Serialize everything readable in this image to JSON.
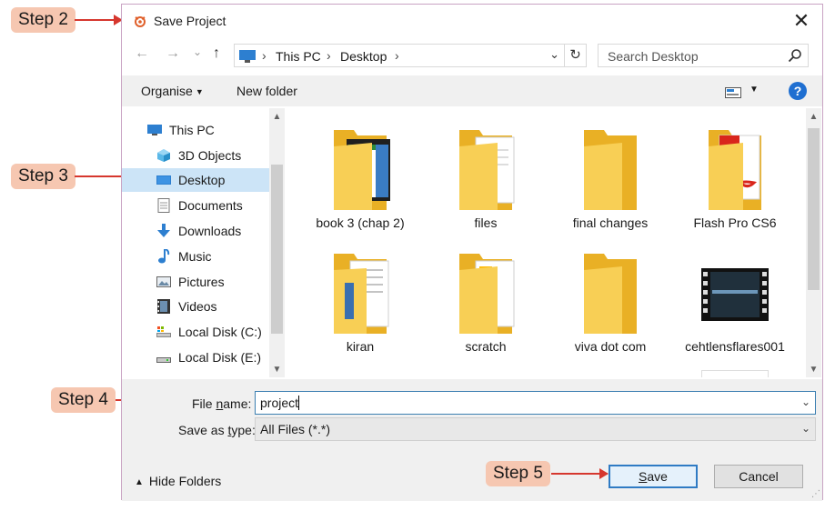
{
  "callouts": [
    "Step 2",
    "Step 3",
    "Step 4",
    "Step 5"
  ],
  "dialog": {
    "title": "Save Project",
    "close_glyph": "✕",
    "nav": {
      "back": "←",
      "forward": "→",
      "recent": "⌄",
      "up": "↑",
      "breadcrumb": [
        "This PC",
        "Desktop"
      ],
      "separator": "›",
      "dropdown": "⌄",
      "refresh": "↻",
      "search_placeholder": "Search Desktop"
    },
    "toolbar": {
      "organise": "Organise",
      "new_folder": "New folder",
      "help": "?"
    },
    "sidebar": {
      "items": [
        {
          "label": "This PC",
          "icon": "pc-icon"
        },
        {
          "label": "3D Objects",
          "icon": "cube-icon"
        },
        {
          "label": "Desktop",
          "icon": "desktop-icon",
          "selected": true
        },
        {
          "label": "Documents",
          "icon": "document-icon"
        },
        {
          "label": "Downloads",
          "icon": "download-icon"
        },
        {
          "label": "Music",
          "icon": "music-icon"
        },
        {
          "label": "Pictures",
          "icon": "picture-icon"
        },
        {
          "label": "Videos",
          "icon": "video-icon"
        },
        {
          "label": "Local Disk (C:)",
          "icon": "drive-c-icon"
        },
        {
          "label": "Local Disk (E:)",
          "icon": "drive-e-icon"
        }
      ]
    },
    "files": [
      {
        "label": "book 3 (chap 2)",
        "kind": "folder"
      },
      {
        "label": "files",
        "kind": "folder"
      },
      {
        "label": "final changes",
        "kind": "folder"
      },
      {
        "label": "Flash Pro CS6",
        "kind": "folder"
      },
      {
        "label": "kiran",
        "kind": "folder"
      },
      {
        "label": "scratch",
        "kind": "folder"
      },
      {
        "label": "viva dot com",
        "kind": "folder"
      },
      {
        "label": "cehtlensflares001",
        "kind": "video"
      }
    ],
    "bottom": {
      "file_name_label_pre": "File ",
      "file_name_label_u": "n",
      "file_name_label_post": "ame:",
      "file_name_value": "project",
      "save_type_label_pre": "Save as ",
      "save_type_label_u": "t",
      "save_type_label_post": "ype:",
      "save_type_value": "All Files (*.*)",
      "hide_folders": "Hide Folders",
      "save_u": "S",
      "save_rest": "ave",
      "cancel": "Cancel"
    },
    "colors": {
      "accent": "#1f6fd1",
      "selection": "#cce4f7",
      "folder": "#f5c23c",
      "callout_bg": "#f6c7b1",
      "arrow": "#d6372e"
    }
  }
}
